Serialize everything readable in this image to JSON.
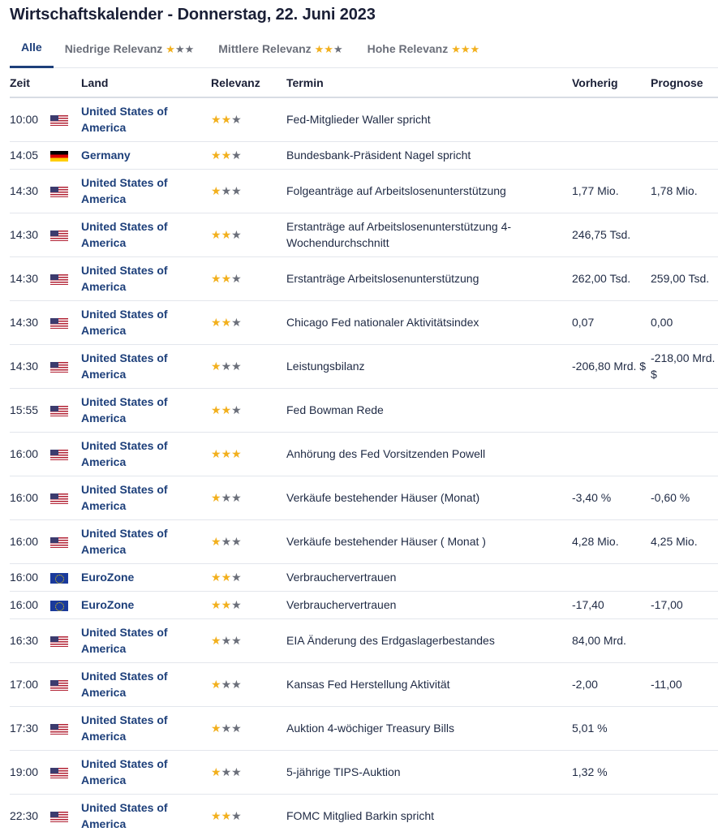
{
  "title": "Wirtschaftskalender - Donnerstag, 22. Juni 2023",
  "tabs": [
    {
      "label": "Alle",
      "active": true,
      "stars": 0
    },
    {
      "label": "Niedrige Relevanz",
      "active": false,
      "stars": 1
    },
    {
      "label": "Mittlere Relevanz",
      "active": false,
      "stars": 2
    },
    {
      "label": "Hohe Relevanz",
      "active": false,
      "stars": 3
    }
  ],
  "columns": {
    "time": "Zeit",
    "country": "Land",
    "relevance": "Relevanz",
    "event": "Termin",
    "previous": "Vorherig",
    "forecast": "Prognose"
  },
  "rows": [
    {
      "time": "10:00",
      "flag": "flag-us",
      "country": "United States of America",
      "stars": 2,
      "event": "Fed-Mitglieder Waller spricht",
      "previous": "",
      "forecast": "",
      "tall": true
    },
    {
      "time": "14:05",
      "flag": "flag-de",
      "country": "Germany",
      "stars": 2,
      "event": "Bundesbank-Präsident Nagel spricht",
      "previous": "",
      "forecast": "",
      "tall": false
    },
    {
      "time": "14:30",
      "flag": "flag-us",
      "country": "United States of America",
      "stars": 1,
      "event": "Folgeanträge auf Arbeitslosenunterstützung",
      "previous": "1,77 Mio.",
      "forecast": "1,78 Mio.",
      "tall": true
    },
    {
      "time": "14:30",
      "flag": "flag-us",
      "country": "United States of America",
      "stars": 2,
      "event": "Erstanträge auf Arbeitslosenunterstützung 4-Wochendurchschnitt",
      "previous": "246,75 Tsd.",
      "forecast": "",
      "tall": true
    },
    {
      "time": "14:30",
      "flag": "flag-us",
      "country": "United States of America",
      "stars": 2,
      "event": "Erstanträge Arbeitslosenunterstützung",
      "previous": "262,00 Tsd.",
      "forecast": "259,00 Tsd.",
      "tall": true
    },
    {
      "time": "14:30",
      "flag": "flag-us",
      "country": "United States of America",
      "stars": 2,
      "event": "Chicago Fed nationaler Aktivitätsindex",
      "previous": "0,07",
      "forecast": "0,00",
      "tall": true
    },
    {
      "time": "14:30",
      "flag": "flag-us",
      "country": "United States of America",
      "stars": 1,
      "event": "Leistungsbilanz",
      "previous": "-206,80 Mrd. $",
      "forecast": "-218,00 Mrd. $",
      "tall": true
    },
    {
      "time": "15:55",
      "flag": "flag-us",
      "country": "United States of America",
      "stars": 2,
      "event": "Fed Bowman Rede",
      "previous": "",
      "forecast": "",
      "tall": true
    },
    {
      "time": "16:00",
      "flag": "flag-us",
      "country": "United States of America",
      "stars": 3,
      "event": "Anhörung des Fed Vorsitzenden Powell",
      "previous": "",
      "forecast": "",
      "tall": true
    },
    {
      "time": "16:00",
      "flag": "flag-us",
      "country": "United States of America",
      "stars": 1,
      "event": "Verkäufe bestehender Häuser (Monat)",
      "previous": "-3,40 %",
      "forecast": "-0,60 %",
      "tall": true
    },
    {
      "time": "16:00",
      "flag": "flag-us",
      "country": "United States of America",
      "stars": 1,
      "event": "Verkäufe bestehender Häuser ( Monat )",
      "previous": "4,28 Mio.",
      "forecast": "4,25 Mio.",
      "tall": true
    },
    {
      "time": "16:00",
      "flag": "flag-eu",
      "country": "EuroZone",
      "stars": 2,
      "event": "Verbrauchervertrauen",
      "previous": "",
      "forecast": "",
      "tall": false
    },
    {
      "time": "16:00",
      "flag": "flag-eu",
      "country": "EuroZone",
      "stars": 2,
      "event": "Verbrauchervertrauen",
      "previous": "-17,40",
      "forecast": "-17,00",
      "tall": false
    },
    {
      "time": "16:30",
      "flag": "flag-us",
      "country": "United States of America",
      "stars": 1,
      "event": "EIA Änderung des Erdgaslagerbestandes",
      "previous": "84,00 Mrd.",
      "forecast": "",
      "tall": true
    },
    {
      "time": "17:00",
      "flag": "flag-us",
      "country": "United States of America",
      "stars": 1,
      "event": "Kansas Fed Herstellung Aktivität",
      "previous": "-2,00",
      "forecast": "-11,00",
      "tall": true
    },
    {
      "time": "17:30",
      "flag": "flag-us",
      "country": "United States of America",
      "stars": 1,
      "event": "Auktion 4-wöchiger Treasury Bills",
      "previous": "5,01 %",
      "forecast": "",
      "tall": true
    },
    {
      "time": "19:00",
      "flag": "flag-us",
      "country": "United States of America",
      "stars": 1,
      "event": "5-jährige TIPS-Auktion",
      "previous": "1,32 %",
      "forecast": "",
      "tall": true
    },
    {
      "time": "22:30",
      "flag": "flag-us",
      "country": "United States of America",
      "stars": 2,
      "event": "FOMC Mitglied Barkin spricht",
      "previous": "",
      "forecast": "",
      "tall": true
    }
  ]
}
